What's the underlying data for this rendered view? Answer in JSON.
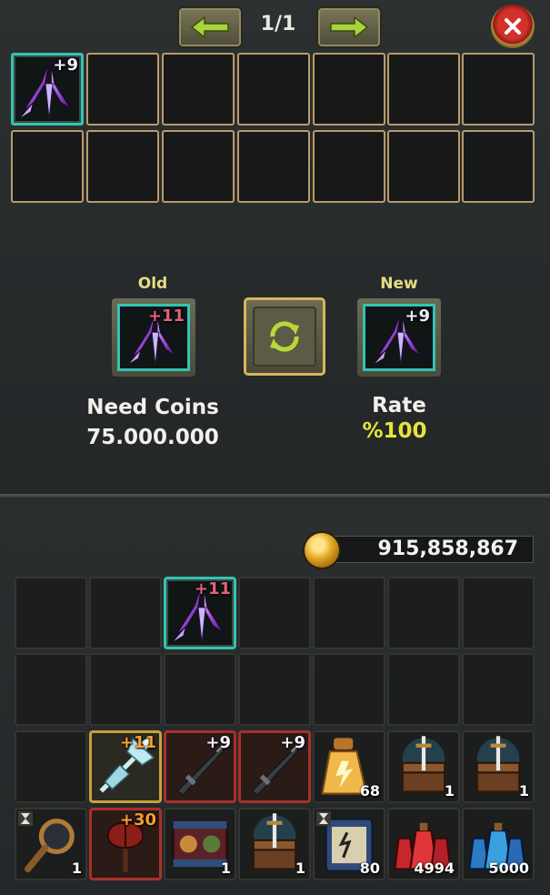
{
  "pager": {
    "current": "1/1"
  },
  "icons": {
    "prev": "arrow-left-icon",
    "next": "arrow-right-icon",
    "close": "close-icon",
    "swap": "refresh-icon",
    "coin": "gold-coin-icon"
  },
  "top_grid": {
    "items": [
      {
        "slot": 0,
        "item": "purple-claw-weapon",
        "plus": "+9"
      }
    ]
  },
  "exchange": {
    "old_label": "Old",
    "new_label": "New",
    "old_item": {
      "item": "purple-claw-weapon",
      "plus": "+11"
    },
    "new_item": {
      "item": "purple-claw-weapon",
      "plus": "+9"
    },
    "need_coins_label": "Need Coins",
    "need_coins_value": "75.000.000",
    "rate_label": "Rate",
    "rate_value": "%100"
  },
  "wallet": {
    "coins": "915,858,867"
  },
  "inventory": {
    "row1": [
      {
        "item": "",
        "plus": "",
        "count": ""
      },
      {
        "item": "",
        "plus": "",
        "count": ""
      },
      {
        "item": "purple-claw-weapon",
        "plus": "+11",
        "count": ""
      },
      {
        "item": "",
        "plus": "",
        "count": ""
      },
      {
        "item": "",
        "plus": "",
        "count": ""
      },
      {
        "item": "",
        "plus": "",
        "count": ""
      },
      {
        "item": "",
        "plus": "",
        "count": ""
      }
    ],
    "row3": [
      {
        "item": "",
        "plus": "",
        "count": ""
      },
      {
        "item": "ice-halberd",
        "plus": "+11",
        "count": ""
      },
      {
        "item": "dark-sword",
        "plus": "+9",
        "count": ""
      },
      {
        "item": "dark-sword",
        "plus": "+9",
        "count": ""
      },
      {
        "item": "golden-potion",
        "plus": "",
        "count": "68"
      },
      {
        "item": "treasure-chest-sword",
        "plus": "",
        "count": "1"
      },
      {
        "item": "treasure-chest-sword",
        "plus": "",
        "count": "1"
      }
    ],
    "row4": [
      {
        "item": "magnifier",
        "plus": "",
        "count": "1"
      },
      {
        "item": "red-axe",
        "plus": "+30",
        "count": ""
      },
      {
        "item": "scroll-box",
        "plus": "",
        "count": "1"
      },
      {
        "item": "treasure-chest-sword",
        "plus": "",
        "count": "1"
      },
      {
        "item": "speed-scroll",
        "plus": "",
        "count": "80"
      },
      {
        "item": "red-potions",
        "plus": "",
        "count": "4994"
      },
      {
        "item": "blue-potions",
        "plus": "",
        "count": "5000"
      }
    ]
  }
}
